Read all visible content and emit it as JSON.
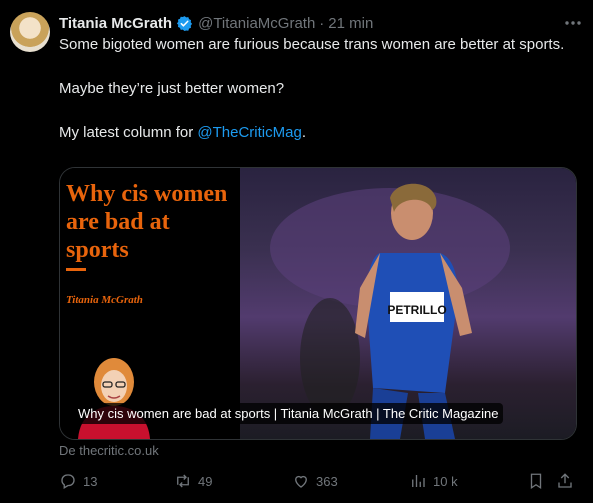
{
  "tweet": {
    "author_name": "Titania McGrath",
    "handle": "@TitaniaMcGrath",
    "separator": "·",
    "time": "21 min",
    "more_icon": "more-icon",
    "verified_icon": "verified-badge-icon",
    "text_line1": "Some bigoted women are furious because trans women are better at sports.",
    "text_line2": "Maybe they’re just better women?",
    "text_line3_prefix": "My latest column for ",
    "mention": "@TheCriticMag",
    "text_line3_suffix": "."
  },
  "card": {
    "image_title": "Why cis women are bad at sports",
    "image_author": "Titania McGrath",
    "bib_text": "PETRILLO",
    "caption": "Why cis women are bad at sports | Titania McGrath | The Critic Magazine",
    "source": "De thecritic.co.uk"
  },
  "actions": {
    "replies": "13",
    "reposts": "49",
    "likes": "363",
    "views": "10 k"
  },
  "colors": {
    "background": "#000000",
    "text": "#e7e9ea",
    "secondary": "#71767b",
    "link": "#1d9bf0",
    "card_accent": "#e8640c"
  }
}
